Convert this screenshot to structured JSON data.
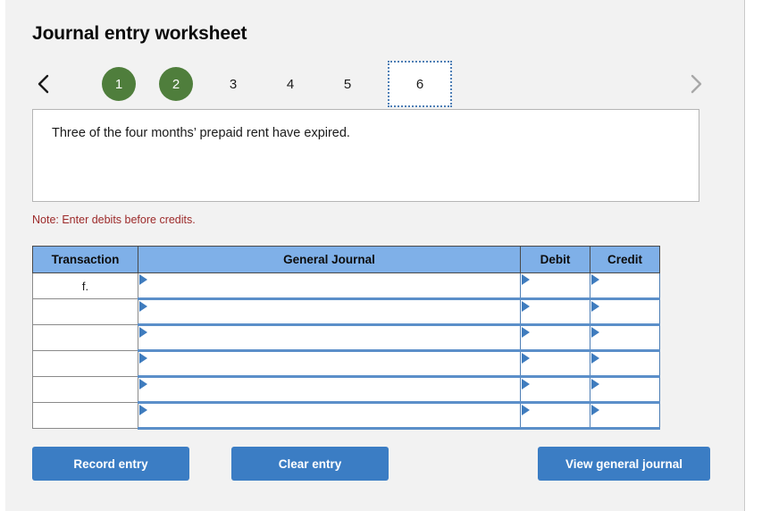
{
  "header": {
    "title": "Journal entry worksheet"
  },
  "step_nav": {
    "prev_icon": "chevron-left-icon",
    "next_icon": "chevron-right-icon",
    "steps": [
      {
        "label": "1",
        "state": "done"
      },
      {
        "label": "2",
        "state": "done"
      },
      {
        "label": "3",
        "state": "pending"
      },
      {
        "label": "4",
        "state": "pending"
      },
      {
        "label": "5",
        "state": "pending"
      },
      {
        "label": "6",
        "state": "current"
      }
    ],
    "done_color": "#4f7e3c",
    "current_border_color": "#4f7fb5"
  },
  "description": {
    "text": "Three of the four months’ prepaid rent have expired."
  },
  "note": {
    "text": "Note: Enter debits before credits.",
    "color": "#9c2a2a"
  },
  "journal_table": {
    "headers": [
      "Transaction",
      "General Journal",
      "Debit",
      "Credit"
    ],
    "header_bg": "#7fb0e8",
    "rows": [
      {
        "transaction": "f.",
        "general_journal": "",
        "debit": "",
        "credit": ""
      },
      {
        "transaction": "",
        "general_journal": "",
        "debit": "",
        "credit": ""
      },
      {
        "transaction": "",
        "general_journal": "",
        "debit": "",
        "credit": ""
      },
      {
        "transaction": "",
        "general_journal": "",
        "debit": "",
        "credit": ""
      },
      {
        "transaction": "",
        "general_journal": "",
        "debit": "",
        "credit": ""
      },
      {
        "transaction": "",
        "general_journal": "",
        "debit": "",
        "credit": ""
      }
    ]
  },
  "buttons": {
    "record": "Record entry",
    "clear": "Clear entry",
    "view": "View general journal",
    "color": "#3b7dc4"
  }
}
